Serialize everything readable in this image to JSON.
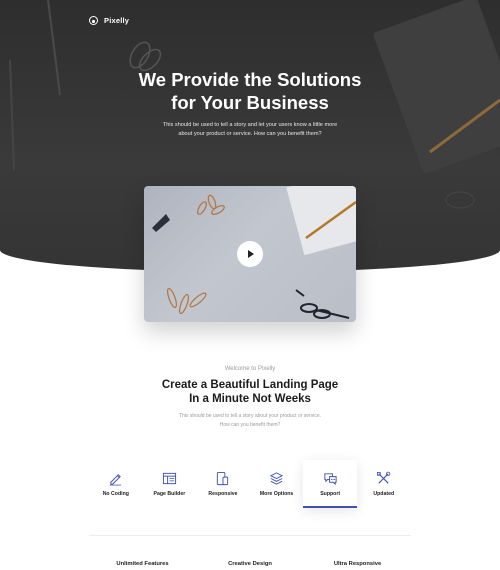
{
  "brand": {
    "name": "Pixelly",
    "icon": "logo-mark-icon"
  },
  "hero": {
    "title_line1": "We Provide the Solutions",
    "title_line2": "for Your Business",
    "subtitle_line1": "This should be used to tell a story and let your users know a little more",
    "subtitle_line2": "about your product or service. How can you benefit them?"
  },
  "video": {
    "play_icon": "play-icon"
  },
  "intro": {
    "eyebrow": "Welcome to Pixelly",
    "title_line1": "Create a Beautiful Landing Page",
    "title_line2": "In a Minute Not Weeks",
    "subtitle_line1": "This should be used to tell a story about your product or service.",
    "subtitle_line2": "How can you benefit them?"
  },
  "features": {
    "active_index": 4,
    "accent_color": "#3f51b5",
    "items": [
      {
        "label": "No Coding",
        "icon": "pencil-icon"
      },
      {
        "label": "Page Builder",
        "icon": "layout-icon"
      },
      {
        "label": "Responsive",
        "icon": "devices-icon"
      },
      {
        "label": "More Options",
        "icon": "layers-icon"
      },
      {
        "label": "Support",
        "icon": "chat-icon"
      },
      {
        "label": "Updated",
        "icon": "tools-icon"
      }
    ]
  },
  "highlights": [
    {
      "label": "Unlimited Features"
    },
    {
      "label": "Creative Design"
    },
    {
      "label": "Ultra Responsive"
    }
  ]
}
